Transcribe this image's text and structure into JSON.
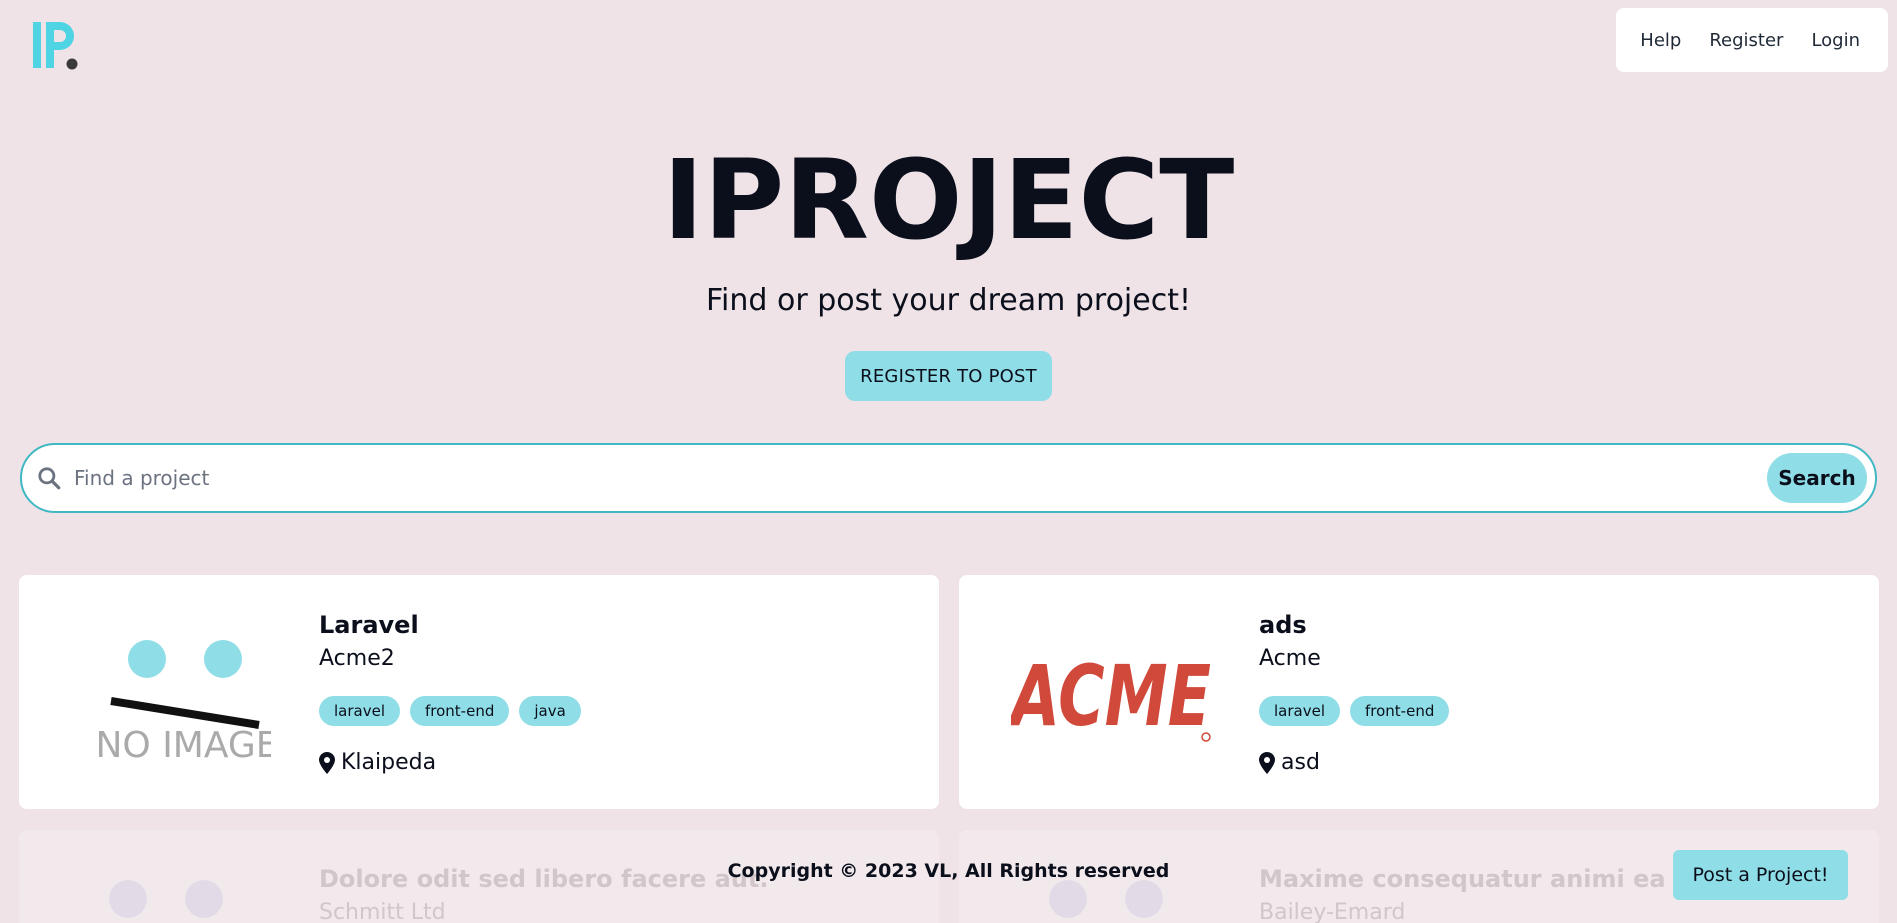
{
  "brand": {
    "logo_letters": "IP",
    "accent_color": "#4fd4e4"
  },
  "nav": {
    "items": [
      {
        "label": "Help"
      },
      {
        "label": "Register"
      },
      {
        "label": "Login"
      }
    ]
  },
  "hero": {
    "title": "IPROJECT",
    "subtitle": "Find or post your dream project!",
    "register_button": "REGISTER TO POST"
  },
  "search": {
    "placeholder": "Find a project",
    "button_label": "Search"
  },
  "projects": [
    {
      "title": "Laravel",
      "company": "Acme2",
      "tags": [
        "laravel",
        "front-end",
        "java"
      ],
      "location": "Klaipeda",
      "image": {
        "type": "no-image",
        "text": "NO IMAGE"
      }
    },
    {
      "title": "ads",
      "company": "Acme",
      "tags": [
        "laravel",
        "front-end"
      ],
      "location": "asd",
      "image": {
        "type": "logo",
        "text": "ACME",
        "color": "#d0493a"
      }
    }
  ],
  "faded_projects": [
    {
      "title": "Dolore odit sed libero facere aut.",
      "company": "Schmitt Ltd"
    },
    {
      "title": "Maxime consequatur animi ea qui sed",
      "company": "Bailey-Emard"
    }
  ],
  "footer": {
    "copyright": "Copyright © 2023 VL, All Rights reserved",
    "post_button": "Post a Project!"
  },
  "colors": {
    "background": "#efe3e7",
    "accent": "#8fdde6",
    "search_border": "#3fb8c4"
  }
}
